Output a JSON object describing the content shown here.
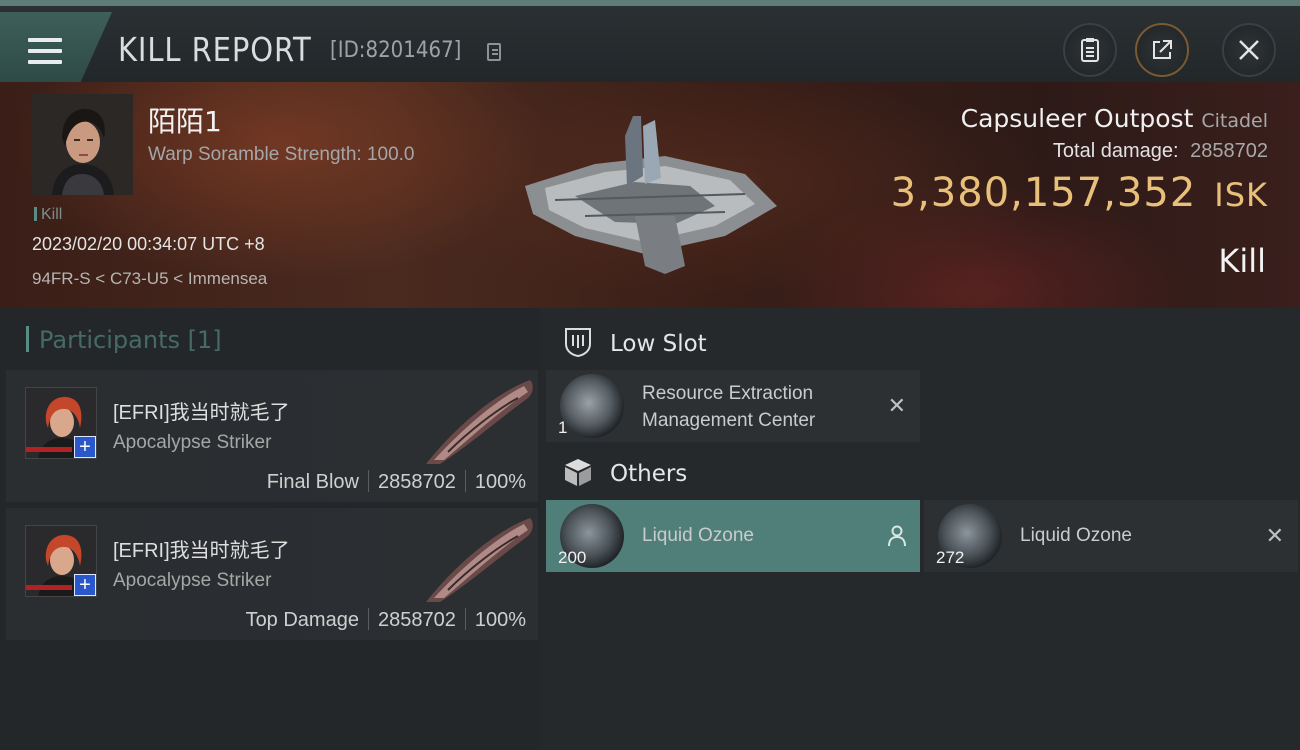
{
  "header": {
    "title": "KILL REPORT",
    "report_id": "[ID:8201467]"
  },
  "victim": {
    "pilot_name": "陌陌1",
    "scramble": "Warp Soramble Strength: 100.0",
    "kill_tag": "Kill",
    "timestamp": "2023/02/20 00:34:07 UTC +8",
    "location": "94FR-S < C73-U5 < Immensea",
    "ship_name": "Capsuleer Outpost",
    "ship_type": "Citadel",
    "total_damage_label": "Total damage:",
    "total_damage_value": "2858702",
    "isk_value": "3,380,157,352",
    "isk_unit": "ISK",
    "result": "Kill"
  },
  "participants": {
    "label": "Participants [1]",
    "rows": [
      {
        "name": "[EFRI]我当时就毛了",
        "ship": "Apocalypse Striker",
        "role": "Final Blow",
        "damage": "2858702",
        "percent": "100%"
      },
      {
        "name": "[EFRI]我当时就毛了",
        "ship": "Apocalypse Striker",
        "role": "Top Damage",
        "damage": "2858702",
        "percent": "100%"
      }
    ]
  },
  "fittings": {
    "low_slot_label": "Low Slot",
    "low_slot_items": [
      {
        "name_line1": "Resource Extraction",
        "name_line2": "Management Center",
        "qty": "1"
      }
    ],
    "others_label": "Others",
    "other_items": [
      {
        "name": "Liquid Ozone",
        "qty": "200"
      },
      {
        "name": "Liquid Ozone",
        "qty": "272"
      }
    ]
  },
  "colors": {
    "accent": "#507e79",
    "isk_gold": "#e9c07a",
    "badge_blue": "#2a57c9"
  },
  "icons": {
    "menu": "hamburger-icon",
    "copy": "copy-icon",
    "clipboard": "clipboard-icon",
    "share": "share-icon",
    "close": "close-icon",
    "low_slot": "low-slot-icon",
    "others": "cube-icon",
    "person": "person-icon",
    "remove": "x-icon"
  }
}
